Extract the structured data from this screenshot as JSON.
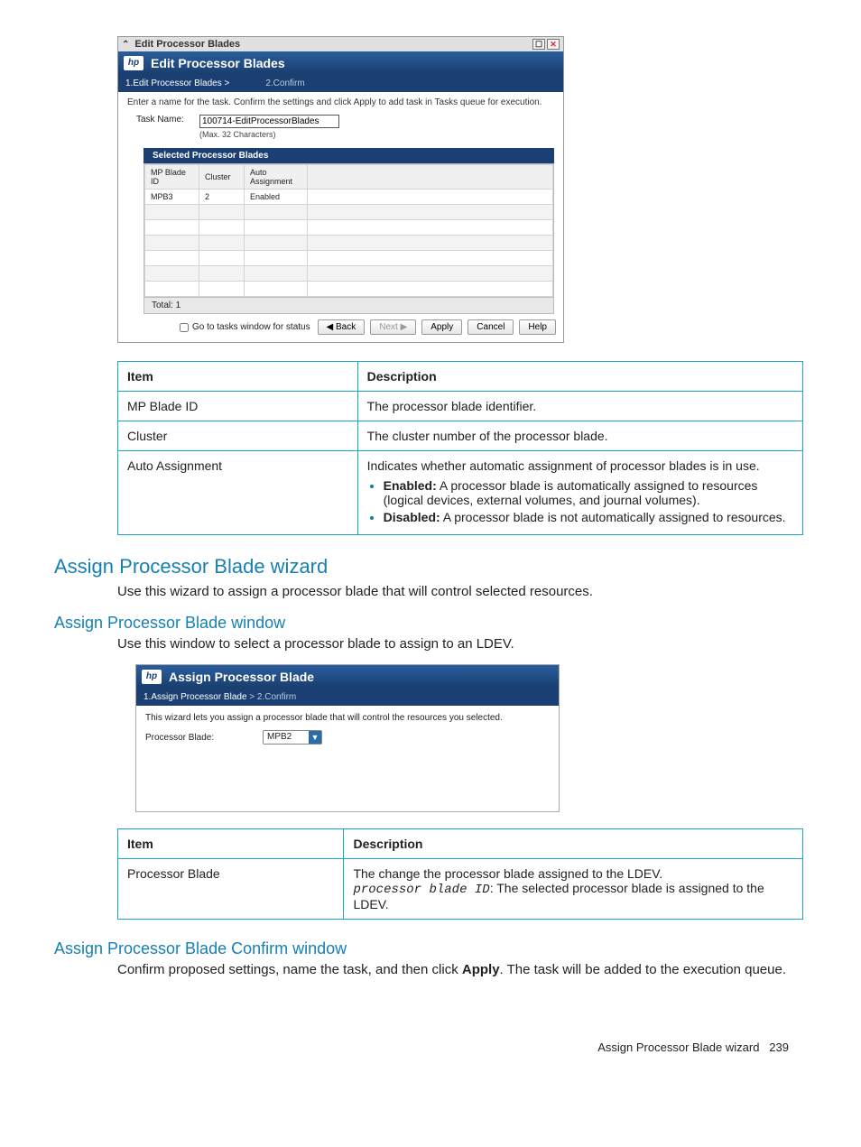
{
  "dialog1": {
    "outer_title": "Edit Processor Blades",
    "header": "Edit Processor Blades",
    "step1": "1.Edit Processor Blades >",
    "step2": "2.Confirm",
    "instruction": "Enter a name for the task. Confirm the settings and click Apply to add task in Tasks queue for execution.",
    "task_name_label": "Task Name:",
    "task_name_value": "100714-EditProcessorBlades",
    "task_name_hint": "(Max. 32 Characters)",
    "selected_header": "Selected Processor Blades",
    "cols": {
      "c1": "MP Blade ID",
      "c2": "Cluster",
      "c3": "Auto Assignment"
    },
    "row": {
      "c1": "MPB3",
      "c2": "2",
      "c3": "Enabled"
    },
    "total": "Total:  1",
    "footer": {
      "checkbox": "Go to tasks window for status",
      "back": "◀ Back",
      "next": "Next ▶",
      "apply": "Apply",
      "cancel": "Cancel",
      "help": "Help"
    }
  },
  "ref_table1": {
    "h1": "Item",
    "h2": "Description",
    "rows": [
      {
        "item": "MP Blade ID",
        "desc": "The processor blade identifier."
      },
      {
        "item": "Cluster",
        "desc": "The cluster number of the processor blade."
      }
    ],
    "auto": {
      "item": "Auto Assignment",
      "desc_intro": "Indicates whether automatic assignment of processor blades is in use.",
      "enabled_label": "Enabled:",
      "enabled_text": " A processor blade is automatically assigned to resources (logical devices, external volumes, and journal volumes).",
      "disabled_label": "Disabled:",
      "disabled_text": " A processor blade is not automatically assigned to resources."
    }
  },
  "headings": {
    "h1": "Assign Processor Blade wizard",
    "p1": "Use this wizard to assign a processor blade that will control selected resources.",
    "h2": "Assign Processor Blade window",
    "p2": "Use this window to select a processor blade to assign to an LDEV.",
    "h3": "Assign Processor Blade Confirm window",
    "p3a": "Confirm proposed settings, name the task, and then click ",
    "p3b": "Apply",
    "p3c": ". The task will be added to the execution queue."
  },
  "dialog2": {
    "header": "Assign Processor Blade",
    "step1": "1.Assign Processor Blade",
    "step_sep": " > ",
    "step2": "2.Confirm",
    "instruction": "This wizard lets you assign a processor blade that will control the resources you selected.",
    "label": "Processor Blade:",
    "value": "MPB2"
  },
  "ref_table2": {
    "h1": "Item",
    "h2": "Description",
    "row": {
      "item": "Processor Blade",
      "desc_line1": "The change the processor blade assigned to the LDEV.",
      "desc_code": "processor blade ID",
      "desc_line2": ": The selected processor blade is assigned to the LDEV."
    }
  },
  "footer": {
    "text": "Assign Processor Blade wizard",
    "page": "239"
  },
  "glyphs": {
    "chev_up": "⌃",
    "max": "☐",
    "close": "✕",
    "tri": "▼"
  }
}
